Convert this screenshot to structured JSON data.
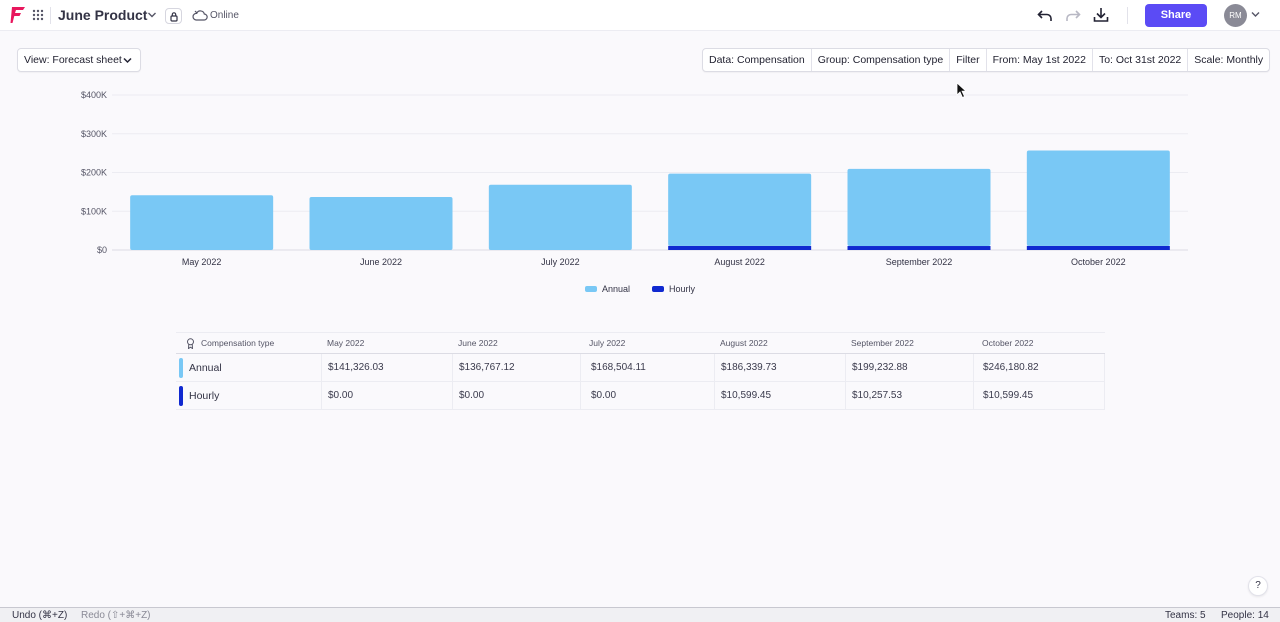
{
  "app": {
    "doc_title": "June Product",
    "status": "Online",
    "share_label": "Share",
    "avatar_initials": "RM",
    "brand_color": "#e8175d",
    "accent_color": "#5b4bf5"
  },
  "toolbar": {
    "view_label": "View: Forecast sheet",
    "filters": [
      "Data: Compensation",
      "Group: Compensation type",
      "Filter",
      "From: May 1st 2022",
      "To: Oct 31st 2022",
      "Scale: Monthly"
    ]
  },
  "chart_data": {
    "type": "bar",
    "stacked": true,
    "categories": [
      "May 2022",
      "June 2022",
      "July 2022",
      "August 2022",
      "September 2022",
      "October 2022"
    ],
    "series": [
      {
        "name": "Annual",
        "color": "#79c8f5",
        "values": [
          141326.03,
          136767.12,
          168504.11,
          186339.73,
          199232.88,
          246180.82
        ]
      },
      {
        "name": "Hourly",
        "color": "#1029d0",
        "values": [
          0,
          0,
          0,
          10599.45,
          10257.53,
          10599.45
        ]
      }
    ],
    "y_ticks": [
      "$0",
      "$100K",
      "$200K",
      "$300K",
      "$400K"
    ],
    "ylim": [
      0,
      400000
    ],
    "grid": true,
    "legend_position": "bottom"
  },
  "table": {
    "header": {
      "group_label": "Compensation type",
      "months": [
        "May 2022",
        "June 2022",
        "July 2022",
        "August 2022",
        "September 2022",
        "October 2022"
      ]
    },
    "rows": [
      {
        "label": "Annual",
        "color": "#79c8f5",
        "values": [
          "$141,326.03",
          "$136,767.12",
          "$168,504.11",
          "$186,339.73",
          "$199,232.88",
          "$246,180.82"
        ]
      },
      {
        "label": "Hourly",
        "color": "#1029d0",
        "values": [
          "$0.00",
          "$0.00",
          "$0.00",
          "$10,599.45",
          "$10,257.53",
          "$10,599.45"
        ]
      }
    ]
  },
  "help_label": "?",
  "bottom_bar": {
    "undo": "Undo (⌘+Z)",
    "redo": "Redo (⇧+⌘+Z)",
    "teams": "Teams: 5",
    "people": "People: 14"
  }
}
